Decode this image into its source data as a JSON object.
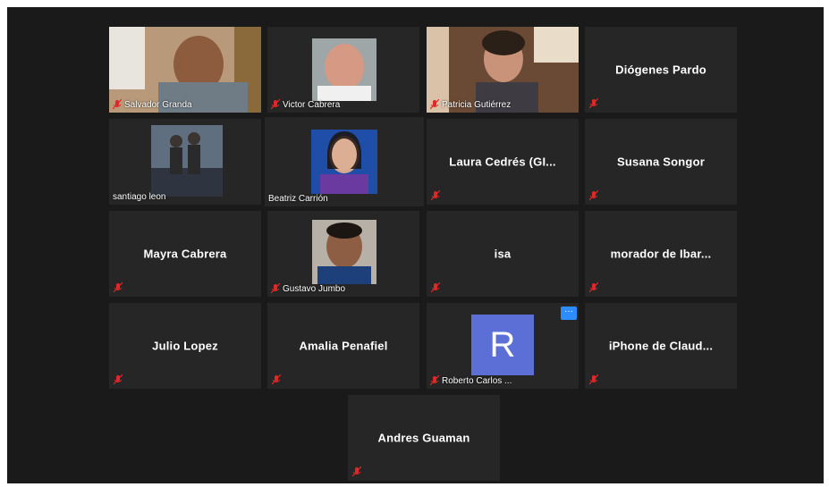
{
  "participants": [
    {
      "name": "Salvador Granda",
      "display": "Salvador Granda",
      "video": true
    },
    {
      "name": "Victor Cabrera",
      "display": "Victor Cabrera",
      "video": true
    },
    {
      "name": "Patricia Gutiérrez",
      "display": "Patricia Gutiérrez",
      "video": true
    },
    {
      "name": "Diógenes Pardo",
      "display": "Diógenes Pardo",
      "video": false
    },
    {
      "name": "santiago leon",
      "display": "santiago leon",
      "video": true
    },
    {
      "name": "Beatriz Carrión",
      "display": "Beatriz Carrión",
      "video": true,
      "active_speaker": true
    },
    {
      "name": "Laura Cedrés (GI...",
      "display": "Laura Cedrés (GI...",
      "video": false
    },
    {
      "name": "Susana Songor",
      "display": "Susana Songor",
      "video": false
    },
    {
      "name": "Mayra Cabrera",
      "display": "Mayra Cabrera",
      "video": false
    },
    {
      "name": "Gustavo Jumbo",
      "display": "Gustavo Jumbo",
      "video": true
    },
    {
      "name": "isa",
      "display": "isa",
      "video": false
    },
    {
      "name": "morador de Ibar...",
      "display": "morador de Ibar...",
      "video": false
    },
    {
      "name": "Julio Lopez",
      "display": "Julio Lopez",
      "video": false
    },
    {
      "name": "Amalia Penafiel",
      "display": "Amalia Penafiel",
      "video": false
    },
    {
      "name": "Roberto Carlos ...",
      "display": "Roberto Carlos ...",
      "video": false,
      "avatar_letter": "R"
    },
    {
      "name": "iPhone de Claud...",
      "display": "iPhone de Claud...",
      "video": false
    },
    {
      "name": "Andres Guaman",
      "display": "Andres Guaman",
      "video": false
    }
  ],
  "more_button_label": "···",
  "colors": {
    "background": "#1a1a1a",
    "tile": "#262626",
    "active_border": "#d8e26a",
    "muted_mic": "#e02828",
    "avatar": "#5b6fd6",
    "more_button": "#2d8cff"
  },
  "icons": {
    "muted_mic": "muted-mic-icon",
    "more": "more-options-icon"
  }
}
